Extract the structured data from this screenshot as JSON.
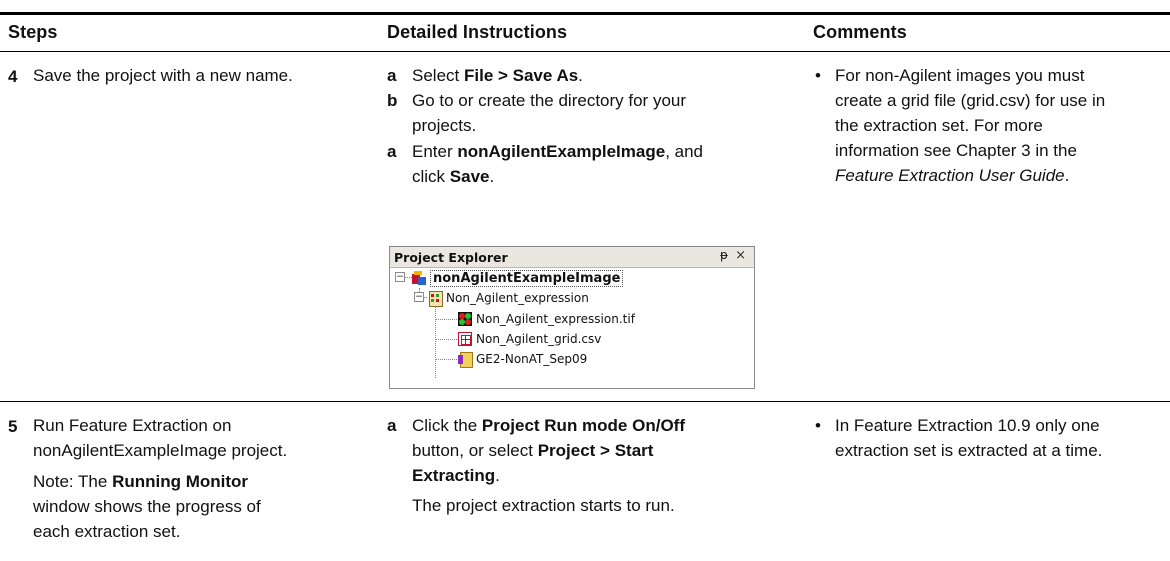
{
  "headers": {
    "steps": "Steps",
    "instructions": "Detailed Instructions",
    "comments": "Comments"
  },
  "row4": {
    "num": "4",
    "step": "Save the project with a new name.",
    "instr": [
      {
        "letter": "a",
        "pre": "Select ",
        "bold": "File > Save As",
        "post": "."
      },
      {
        "letter": "b",
        "line1": "Go to or create the directory for your",
        "line2": "projects."
      },
      {
        "letter": "a",
        "bold1": "nonAgilentExampleImage",
        "pre1": "Enter ",
        "post1": ", and",
        "pre2": "click ",
        "bold2": "Save",
        "post2": "."
      }
    ],
    "comment": {
      "bullet": "•",
      "l1": "For non-Agilent images you must",
      "l2": "create a grid file (grid.csv) for use in",
      "l3": "the extraction set. For more",
      "l4": "information see Chapter 3 in the",
      "l5_italic": "Feature Extraction User Guide",
      "l5_post": "."
    }
  },
  "explorer": {
    "title": "Project Explorer",
    "pin": "ᵽ",
    "close": "×",
    "root": "nonAgilentExampleImage",
    "child": "Non_Agilent_expression",
    "items": [
      "Non_Agilent_expression.tif",
      "Non_Agilent_grid.csv",
      "GE2-NonAT_Sep09"
    ],
    "expander": "−"
  },
  "row5": {
    "num": "5",
    "step_l1": "Run Feature Extraction on",
    "step_l2": "nonAgilentExampleImage project.",
    "note_pre": "Note: The ",
    "note_bold": "Running Monitor",
    "note_l2": "window shows the progress of",
    "note_l3": "each extraction set.",
    "instr_letter": "a",
    "instr_l1_pre": "Click the ",
    "instr_l1_bold": "Project Run mode On/Off",
    "instr_l2_pre": "button, or select ",
    "instr_l2_bold": "Project > Start",
    "instr_l3_bold": "Extracting",
    "instr_l3_post": ".",
    "instr_result": "The project extraction starts to run.",
    "comment_bullet": "•",
    "comment_l1": "In Feature Extraction 10.9 only one",
    "comment_l2": "extraction set is extracted at a time."
  }
}
